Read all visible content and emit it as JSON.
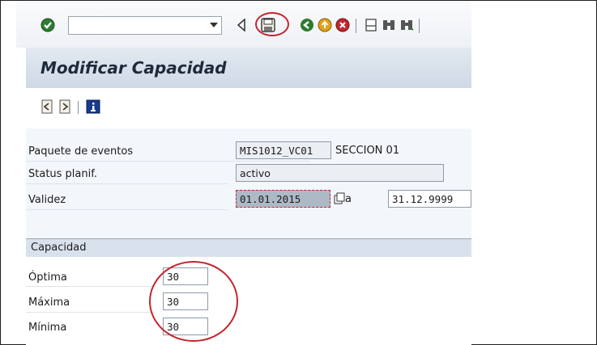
{
  "toolbar": {
    "command_value": "",
    "icons": [
      "checkmark-icon",
      "save-icon",
      "back-icon",
      "exit-icon",
      "cancel-icon",
      "print-icon",
      "find-icon",
      "find-next-icon"
    ]
  },
  "title": "Modificar Capacidad",
  "form": {
    "paquete_label": "Paquete de eventos",
    "paquete_value": "MIS1012_VC01",
    "paquete_text": "SECCION 01",
    "status_label": "Status planif.",
    "status_value": "activo",
    "validez_label": "Validez",
    "validez_from": "01.01.2015",
    "validez_sep": "a",
    "validez_to": "31.12.9999"
  },
  "capacidad": {
    "title": "Capacidad",
    "optima_label": "Óptima",
    "optima_value": "30",
    "maxima_label": "Máxima",
    "maxima_value": "30",
    "minima_label": "Mínima",
    "minima_value": "30"
  },
  "colors": {
    "annotation_red": "#c2262e",
    "title_bg": "#d5dfea"
  }
}
